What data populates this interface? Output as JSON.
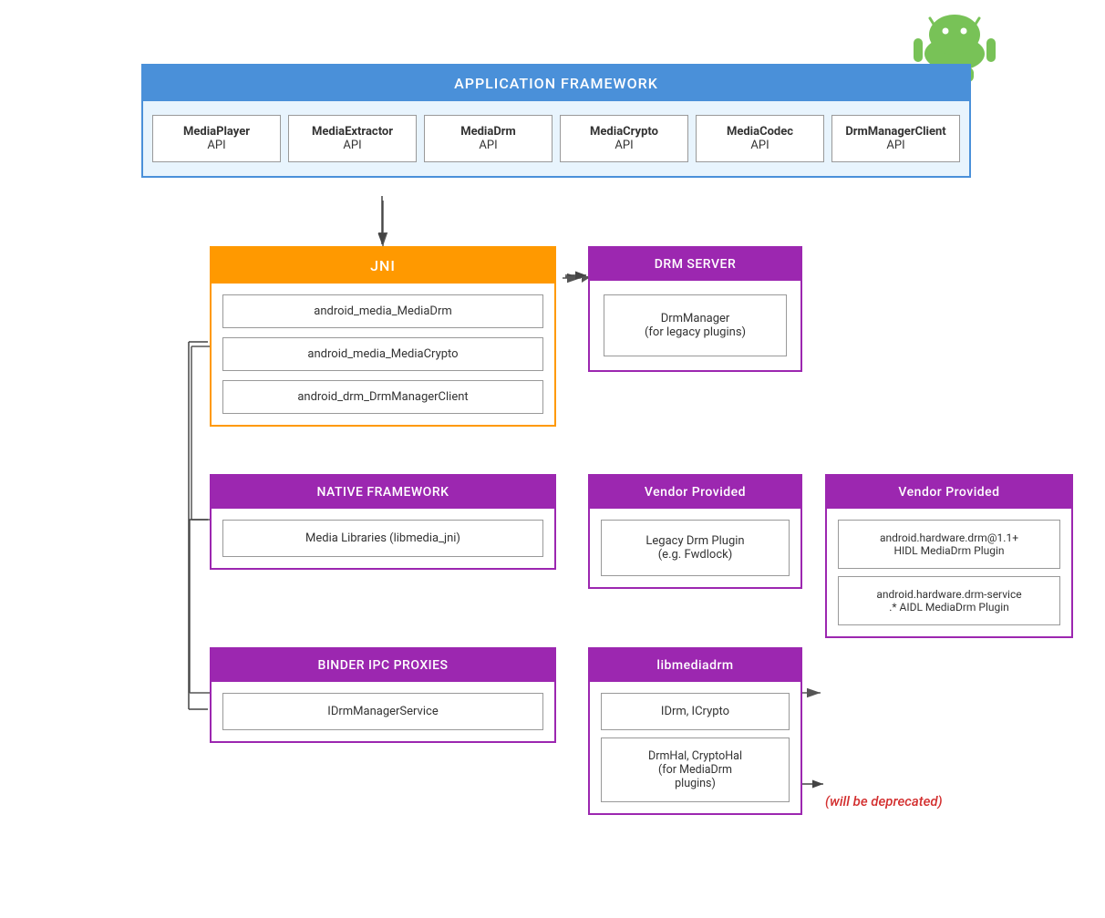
{
  "android_logo": {
    "color_body": "#78C257",
    "color_antenna": "#5A9E42"
  },
  "app_framework": {
    "header": "APPLICATION FRAMEWORK",
    "apis": [
      {
        "line1": "MediaPlayer",
        "line2": "API"
      },
      {
        "line1": "MediaExtractor",
        "line2": "API"
      },
      {
        "line1": "MediaDrm",
        "line2": "API"
      },
      {
        "line1": "MediaCrypto",
        "line2": "API"
      },
      {
        "line1": "MediaCodec",
        "line2": "API"
      },
      {
        "line1": "DrmManagerClient",
        "line2": "API"
      }
    ]
  },
  "jni": {
    "header": "JNI",
    "items": [
      "android_media_MediaDrm",
      "android_media_MediaCrypto",
      "android_drm_DrmManagerClient"
    ]
  },
  "drm_server": {
    "header": "DRM SERVER",
    "item": "DrmManager\n(for legacy plugins)"
  },
  "native_framework": {
    "header": "NATIVE FRAMEWORK",
    "item": "Media Libraries (libmedia_jni)"
  },
  "vendor1": {
    "header": "Vendor Provided",
    "item": "Legacy Drm Plugin\n(e.g. Fwdlock)"
  },
  "vendor2": {
    "header": "Vendor Provided",
    "items": [
      "android.hardware.drm@1.1+\nHIDL MediaDrm Plugin",
      "android.hardware.drm-service\n.* AIDL MediaDrm Plugin"
    ]
  },
  "binder": {
    "header": "BINDER IPC PROXIES",
    "item": "IDrmManagerService"
  },
  "libmediadrm": {
    "header": "libmediadrm",
    "items": [
      "IDrm, ICrypto",
      "DrmHal, CryptoHal\n(for MediaDrm\nplugins)"
    ]
  },
  "deprecated": "(will be deprecated)"
}
